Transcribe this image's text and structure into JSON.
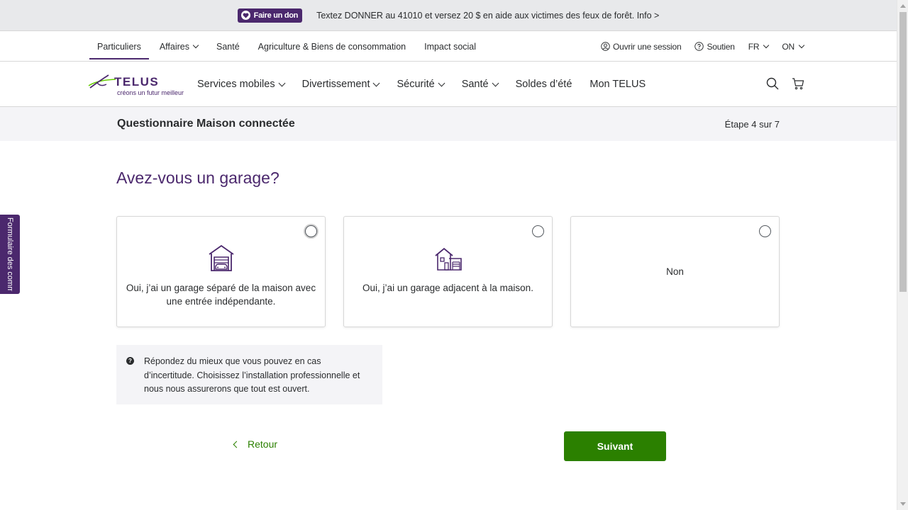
{
  "banner": {
    "donate_label": "Faire un don",
    "message": "Textez DONNER au 41010 et versez 20 $ en aide aux victimes des feux de forêt. Info >"
  },
  "utility_nav": {
    "left": [
      "Particuliers",
      "Affaires",
      "Santé",
      "Agriculture & Biens de consommation",
      "Impact social"
    ],
    "active": "Particuliers",
    "signin": "Ouvrir une session",
    "support": "Soutien",
    "language": "FR",
    "province": "ON"
  },
  "main_nav": {
    "logo_word": "TELUS",
    "logo_tagline": "créons un futur meilleur",
    "items": [
      "Services mobiles",
      "Divertissement",
      "Sécurité",
      "Santé",
      "Soldes d’été",
      "Mon TELUS"
    ]
  },
  "questionnaire": {
    "title": "Questionnaire Maison connectée",
    "step": "Étape 4 sur 7"
  },
  "feedback_tab": "Formulaire des comment",
  "question": "Avez-vous un garage?",
  "options": [
    {
      "label": "Oui, j’ai un garage séparé de la maison avec une entrée indépendante.",
      "icon": "detached-garage-icon"
    },
    {
      "label": "Oui, j’ai un garage adjacent à la maison.",
      "icon": "attached-garage-icon"
    },
    {
      "label": "Non",
      "icon": ""
    }
  ],
  "info": {
    "text": "Répondez du mieux que vous pouvez en cas d’incertitude. Choisissez l’installation professionnelle et nous nous assurerons que tout est ouvert."
  },
  "buttons": {
    "back": "Retour",
    "next": "Suivant"
  },
  "colors": {
    "brand_purple": "#4b286d",
    "brand_green": "#2b8000",
    "logo_green": "#66cc00"
  }
}
